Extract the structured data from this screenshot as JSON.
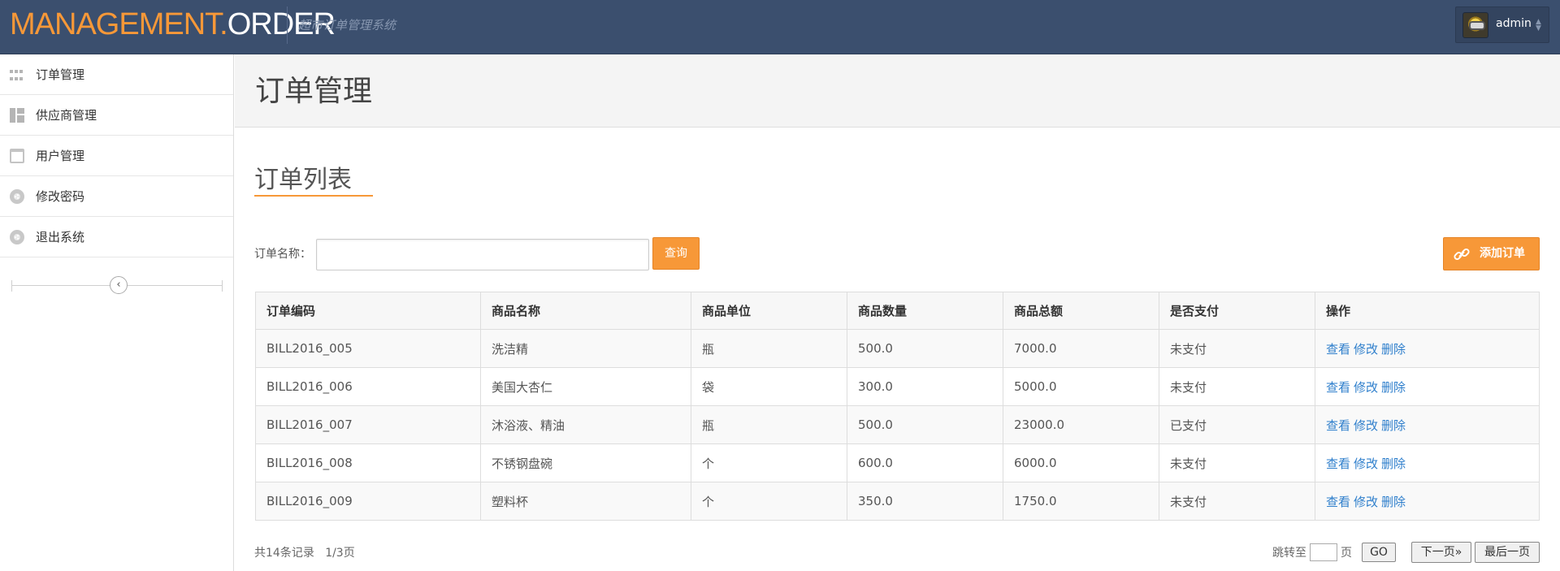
{
  "header": {
    "brand_part1": "MANAGEMENT.",
    "brand_part2": "ORDER",
    "subtitle": "超市订单管理系统",
    "user_name": "admin"
  },
  "sidebar": {
    "items": [
      {
        "label": "订单管理",
        "icon": "grid-icon"
      },
      {
        "label": "供应商管理",
        "icon": "dashboard-icon"
      },
      {
        "label": "用户管理",
        "icon": "calendar-icon"
      },
      {
        "label": "修改密码",
        "icon": "lifebuoy-icon"
      },
      {
        "label": "退出系统",
        "icon": "lifebuoy-icon"
      }
    ],
    "collapse_icon": "chevron-left-icon"
  },
  "main": {
    "page_title": "订单管理",
    "section_title": "订单列表",
    "search": {
      "label": "订单名称：",
      "value": "",
      "button": "查询"
    },
    "add_button": "添加订单",
    "add_icon": "link-icon",
    "table": {
      "headers": [
        "订单编码",
        "商品名称",
        "商品单位",
        "商品数量",
        "商品总额",
        "是否支付",
        "操作"
      ],
      "rows": [
        [
          "BILL2016_005",
          "洗洁精",
          "瓶",
          "500.0",
          "7000.0",
          "未支付"
        ],
        [
          "BILL2016_006",
          "美国大杏仁",
          "袋",
          "300.0",
          "5000.0",
          "未支付"
        ],
        [
          "BILL2016_007",
          "沐浴液、精油",
          "瓶",
          "500.0",
          "23000.0",
          "已支付"
        ],
        [
          "BILL2016_008",
          "不锈钢盘碗",
          "个",
          "600.0",
          "6000.0",
          "未支付"
        ],
        [
          "BILL2016_009",
          "塑料杯",
          "个",
          "350.0",
          "1750.0",
          "未支付"
        ]
      ],
      "actions": [
        "查看",
        "修改",
        "删除"
      ]
    },
    "pagination": {
      "records": "共14条记录",
      "pages": "1/3页",
      "jump_label": "跳转至",
      "jump_suffix": "页",
      "go": "GO",
      "next": "下一页»",
      "last": "最后一页"
    }
  },
  "colors": {
    "navbar": "#3b4f6e",
    "accent": "#f79838",
    "link": "#2f7fcc"
  }
}
